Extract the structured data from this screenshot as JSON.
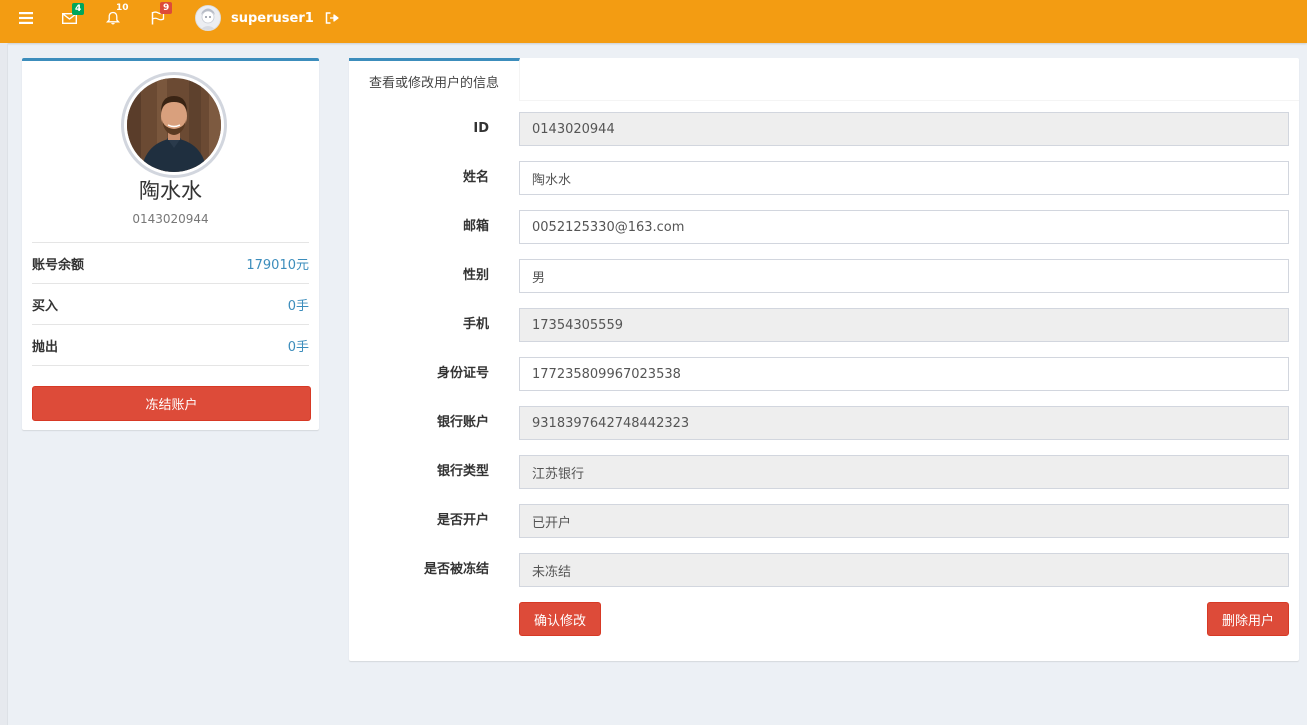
{
  "navbar": {
    "mail_count": "4",
    "notification_count": "10",
    "flag_count": "9",
    "username": "superuser1",
    "icons": {
      "menu": "hamburger-icon",
      "mail": "envelope-icon",
      "bell": "bell-icon",
      "flag": "flag-icon",
      "logout": "sign-out-icon"
    }
  },
  "profile": {
    "name": "陶水水",
    "id": "0143020944",
    "stats": [
      {
        "label": "账号余额",
        "value": "179010元"
      },
      {
        "label": "买入",
        "value": "0手"
      },
      {
        "label": "抛出",
        "value": "0手"
      }
    ],
    "freeze_button": "冻结账户"
  },
  "tab": {
    "title": "查看或修改用户的信息"
  },
  "form": {
    "fields": [
      {
        "label": "ID",
        "value": "0143020944",
        "readonly": true
      },
      {
        "label": "姓名",
        "value": "陶水水",
        "readonly": false
      },
      {
        "label": "邮箱",
        "value": "0052125330@163.com",
        "readonly": false
      },
      {
        "label": "性别",
        "value": "男",
        "readonly": false
      },
      {
        "label": "手机",
        "value": "17354305559",
        "readonly": true
      },
      {
        "label": "身份证号",
        "value": "177235809967023538",
        "readonly": false
      },
      {
        "label": "银行账户",
        "value": "9318397642748442323",
        "readonly": true
      },
      {
        "label": "银行类型",
        "value": "江苏银行",
        "readonly": true
      },
      {
        "label": "是否开户",
        "value": "已开户",
        "readonly": true
      },
      {
        "label": "是否被冻结",
        "value": "未冻结",
        "readonly": true
      }
    ],
    "confirm_button": "确认修改",
    "delete_button": "删除用户"
  },
  "colors": {
    "topbar": "#f39c12",
    "accent": "#3c8dbc",
    "danger": "#dd4b39",
    "badge_green": "#00a65a"
  }
}
